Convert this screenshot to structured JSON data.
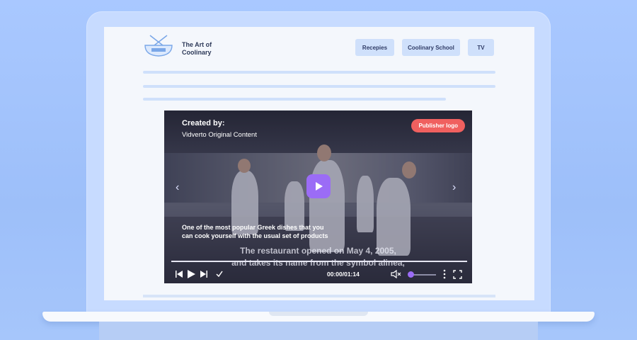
{
  "site": {
    "brand_name": "The Art of Coolinary",
    "nav": [
      "Recepies",
      "Coolinary School",
      "TV"
    ]
  },
  "player": {
    "created_label": "Created by:",
    "creator": "Vidverto Original Content",
    "publisher_logo": "Publisher logo",
    "description": "One of the most popular Greek dishes that you can cook yourself with the usual set of products",
    "subtitle_line1": "The restaurant opened on May 4, 2005,",
    "subtitle_line2": "and takes its name from the symbol alinea,",
    "time": "00:00/01:14"
  },
  "colors": {
    "accent": "#9b6cf6",
    "publisher_badge": "#f0605f",
    "nav_button": "#cfe0fb"
  }
}
